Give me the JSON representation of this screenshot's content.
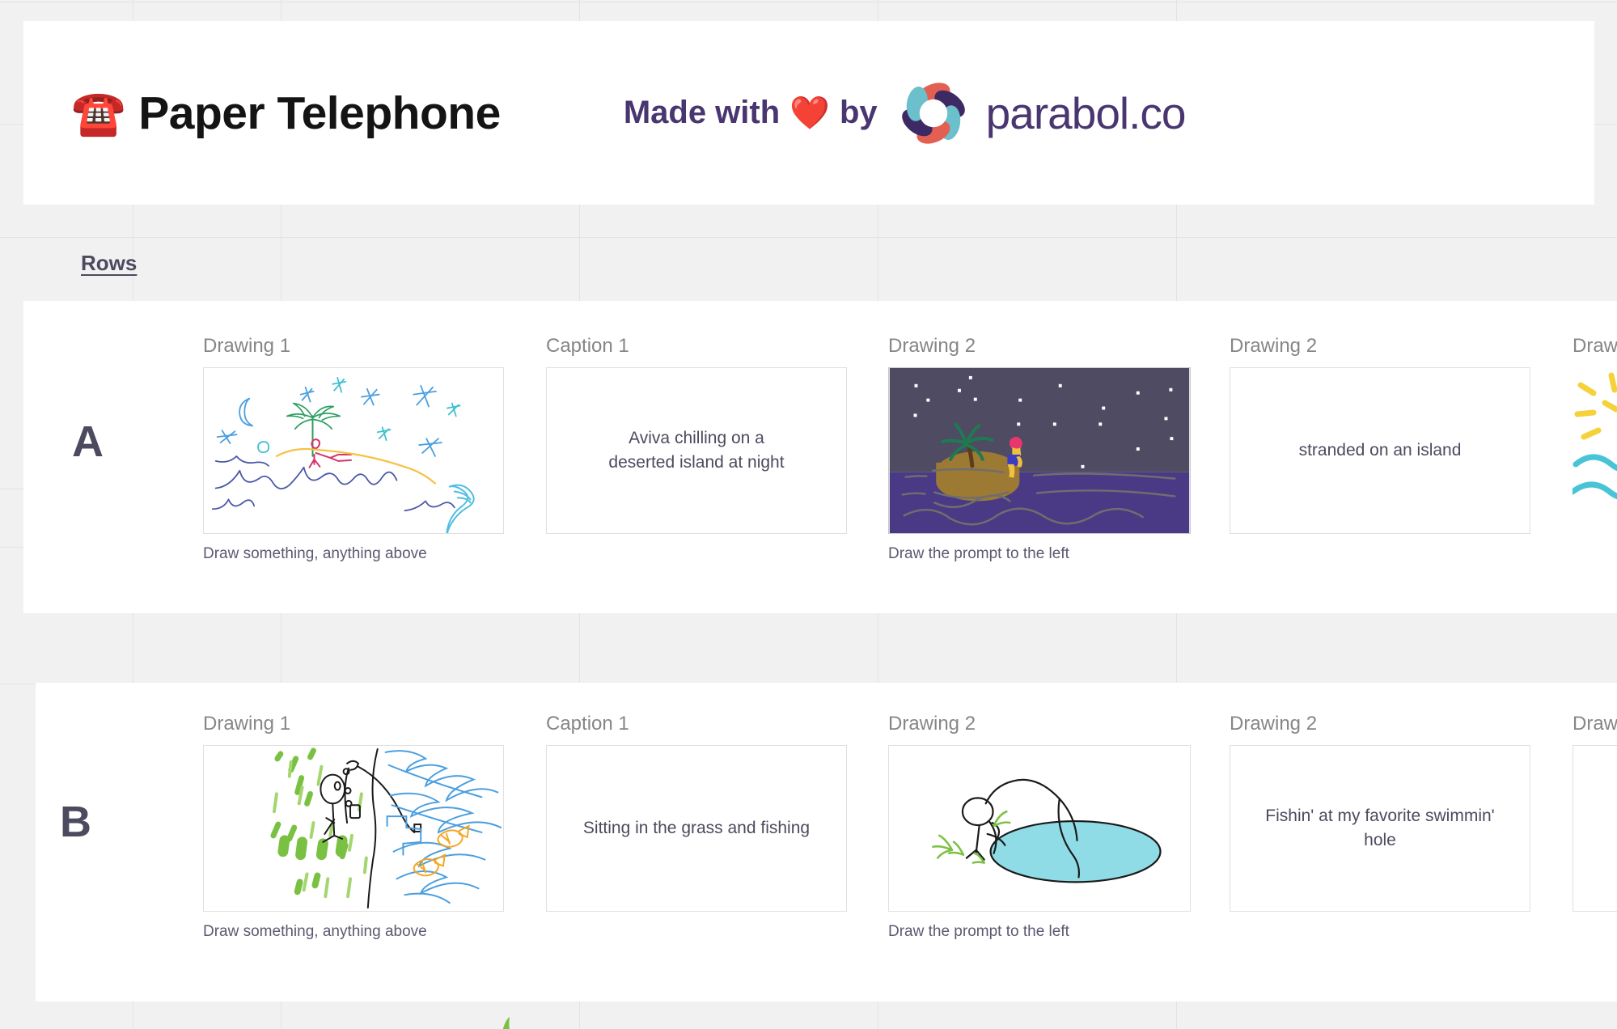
{
  "header": {
    "phone_icon": "telephone-emoji",
    "title": "Paper Telephone",
    "made_with_prefix": "Made with",
    "heart_icon": "red-heart-emoji",
    "made_with_by": "by",
    "brand_logo": "parabol-logo-icon",
    "brand_name": "parabol.co",
    "brand_color": "#493670"
  },
  "rows_label": "Rows",
  "columns": [
    {
      "header": "Drawing 1",
      "hint": "Draw something, anything above"
    },
    {
      "header": "Caption 1",
      "hint": ""
    },
    {
      "header": "Drawing 2",
      "hint": "Draw the prompt to the left"
    },
    {
      "header": "Drawing 2",
      "hint": ""
    },
    {
      "header": "Draw",
      "hint": ""
    }
  ],
  "rows": [
    {
      "letter": "A",
      "drawing1_alt": "night-beach-doodle",
      "caption1": "Aviva chilling on a\ndeserted island at night",
      "drawing2_alt": "night-island-painting",
      "caption2": "stranded on an island",
      "drawing3_alt": "sun-and-waves-doodle"
    },
    {
      "letter": "B",
      "drawing1_alt": "stick-figure-fishing-in-grass-doodle",
      "caption1": "Sitting in the grass and fishing",
      "drawing2_alt": "fishing-at-pond-doodle",
      "caption2": "Fishin' at my favorite swimmin' hole",
      "drawing3_alt": "partial-doodle"
    }
  ],
  "colors": {
    "page_bg": "#f1f1f1",
    "card_bg": "#ffffff",
    "header_text": "#868686",
    "body_text": "#4c4a5e",
    "night_sky": "#4e4b63",
    "night_water": "#4a3a86",
    "island_sand": "#9c7a33"
  }
}
